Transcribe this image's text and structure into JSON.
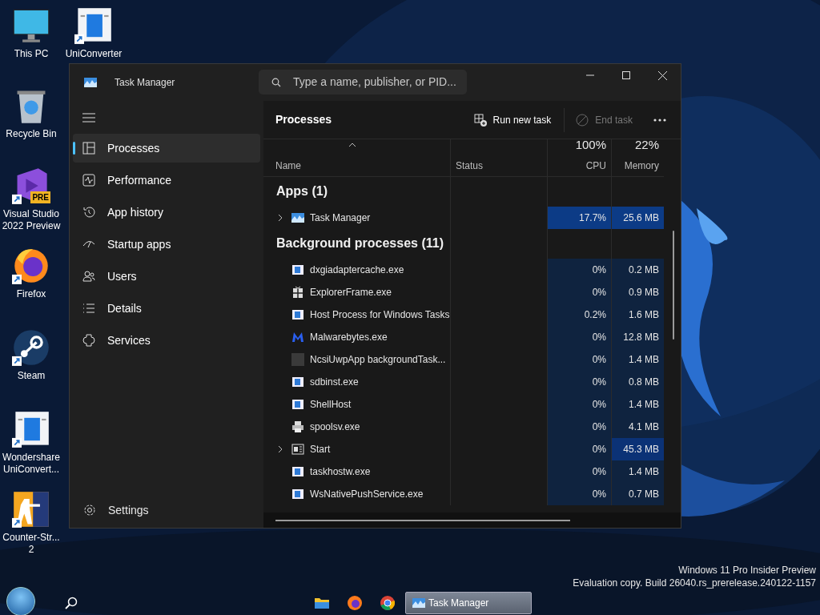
{
  "desktop_icons": [
    {
      "label": "This PC",
      "kind": "monitor"
    },
    {
      "label": "UniConverter",
      "kind": "doc"
    },
    {
      "label": "Recycle Bin",
      "kind": "bin"
    },
    {
      "label": "Visual Studio 2022 Preview",
      "kind": "vs",
      "badge": "PRE"
    },
    {
      "label": "Firefox",
      "kind": "firefox"
    },
    {
      "label": "Steam",
      "kind": "steam"
    },
    {
      "label": "Wondershare UniConvert...",
      "kind": "doc"
    },
    {
      "label": "Counter-Str... 2",
      "kind": "cs"
    }
  ],
  "window": {
    "title": "Task Manager",
    "search": {
      "placeholder": "Type a name, publisher, or PID..."
    }
  },
  "sidebar": {
    "items": [
      {
        "label": "Processes",
        "kind": "processes",
        "selected": true
      },
      {
        "label": "Performance",
        "kind": "performance",
        "selected": false
      },
      {
        "label": "App history",
        "kind": "history",
        "selected": false
      },
      {
        "label": "Startup apps",
        "kind": "startup",
        "selected": false
      },
      {
        "label": "Users",
        "kind": "users",
        "selected": false
      },
      {
        "label": "Details",
        "kind": "details",
        "selected": false
      },
      {
        "label": "Services",
        "kind": "services",
        "selected": false
      }
    ],
    "settings": "Settings"
  },
  "toolbar": {
    "title": "Processes",
    "run_new_task": "Run new task",
    "end_task": {
      "label": "End task",
      "disabled": true
    }
  },
  "table": {
    "columns": [
      {
        "label": "Name"
      },
      {
        "label": "Status"
      },
      {
        "total": "100%",
        "label": "CPU"
      },
      {
        "total": "22%",
        "label": "Memory"
      }
    ],
    "groups": [
      {
        "title": "Apps (1)",
        "rows": [
          {
            "name": "Task Manager",
            "kind": "taskmgr",
            "expandable": true,
            "cpu": {
              "text": "17.7%",
              "color": "#0c3b86"
            },
            "memory": {
              "text": "25.6 MB",
              "color": "#0c3b86"
            }
          }
        ]
      },
      {
        "title": "Background processes (11)",
        "rows": [
          {
            "name": "dxgiadaptercache.exe",
            "kind": "app",
            "expandable": false,
            "cpu": {
              "text": "0%",
              "color": "#0f233f"
            },
            "memory": {
              "text": "0.2 MB",
              "color": "#0f233f"
            }
          },
          {
            "name": "ExplorerFrame.exe",
            "kind": "gift",
            "expandable": false,
            "cpu": {
              "text": "0%",
              "color": "#0f233f"
            },
            "memory": {
              "text": "0.9 MB",
              "color": "#0f233f"
            }
          },
          {
            "name": "Host Process for Windows Tasks",
            "kind": "app",
            "expandable": false,
            "cpu": {
              "text": "0.2%",
              "color": "#0f233f"
            },
            "memory": {
              "text": "1.6 MB",
              "color": "#0f233f"
            }
          },
          {
            "name": "Malwarebytes.exe",
            "kind": "malware",
            "expandable": false,
            "cpu": {
              "text": "0%",
              "color": "#0f233f"
            },
            "memory": {
              "text": "12.8 MB",
              "color": "#0f233f"
            }
          },
          {
            "name": "NcsiUwpApp backgroundTask...",
            "kind": "blank",
            "expandable": false,
            "cpu": {
              "text": "0%",
              "color": "#0f233f"
            },
            "memory": {
              "text": "1.4 MB",
              "color": "#0f233f"
            }
          },
          {
            "name": "sdbinst.exe",
            "kind": "app",
            "expandable": false,
            "cpu": {
              "text": "0%",
              "color": "#0f233f"
            },
            "memory": {
              "text": "0.8 MB",
              "color": "#0f233f"
            }
          },
          {
            "name": "ShellHost",
            "kind": "app",
            "expandable": false,
            "cpu": {
              "text": "0%",
              "color": "#0f233f"
            },
            "memory": {
              "text": "1.4 MB",
              "color": "#0f233f"
            }
          },
          {
            "name": "spoolsv.exe",
            "kind": "printer",
            "expandable": false,
            "cpu": {
              "text": "0%",
              "color": "#0f233f"
            },
            "memory": {
              "text": "4.1 MB",
              "color": "#0f233f"
            }
          },
          {
            "name": "Start",
            "kind": "start",
            "expandable": true,
            "cpu": {
              "text": "0%",
              "color": "#0f233f"
            },
            "memory": {
              "text": "45.3 MB",
              "color": "#0b3276"
            }
          },
          {
            "name": "taskhostw.exe",
            "kind": "app",
            "expandable": false,
            "cpu": {
              "text": "0%",
              "color": "#0f233f"
            },
            "memory": {
              "text": "1.4 MB",
              "color": "#0f233f"
            }
          },
          {
            "name": "WsNativePushService.exe",
            "kind": "app",
            "expandable": false,
            "cpu": {
              "text": "0%",
              "color": "#0f233f"
            },
            "memory": {
              "text": "0.7 MB",
              "color": "#0f233f"
            }
          }
        ]
      }
    ]
  },
  "watermark_notice": [
    "Windows 11 Pro Insider Preview",
    "Evaluation copy. Build 26040.rs_prerelease.240122-1157"
  ],
  "taskbar": {
    "pinned": [
      {
        "kind": "folder"
      },
      {
        "kind": "firefox"
      },
      {
        "kind": "chrome"
      }
    ],
    "task_button": "Task Manager"
  }
}
